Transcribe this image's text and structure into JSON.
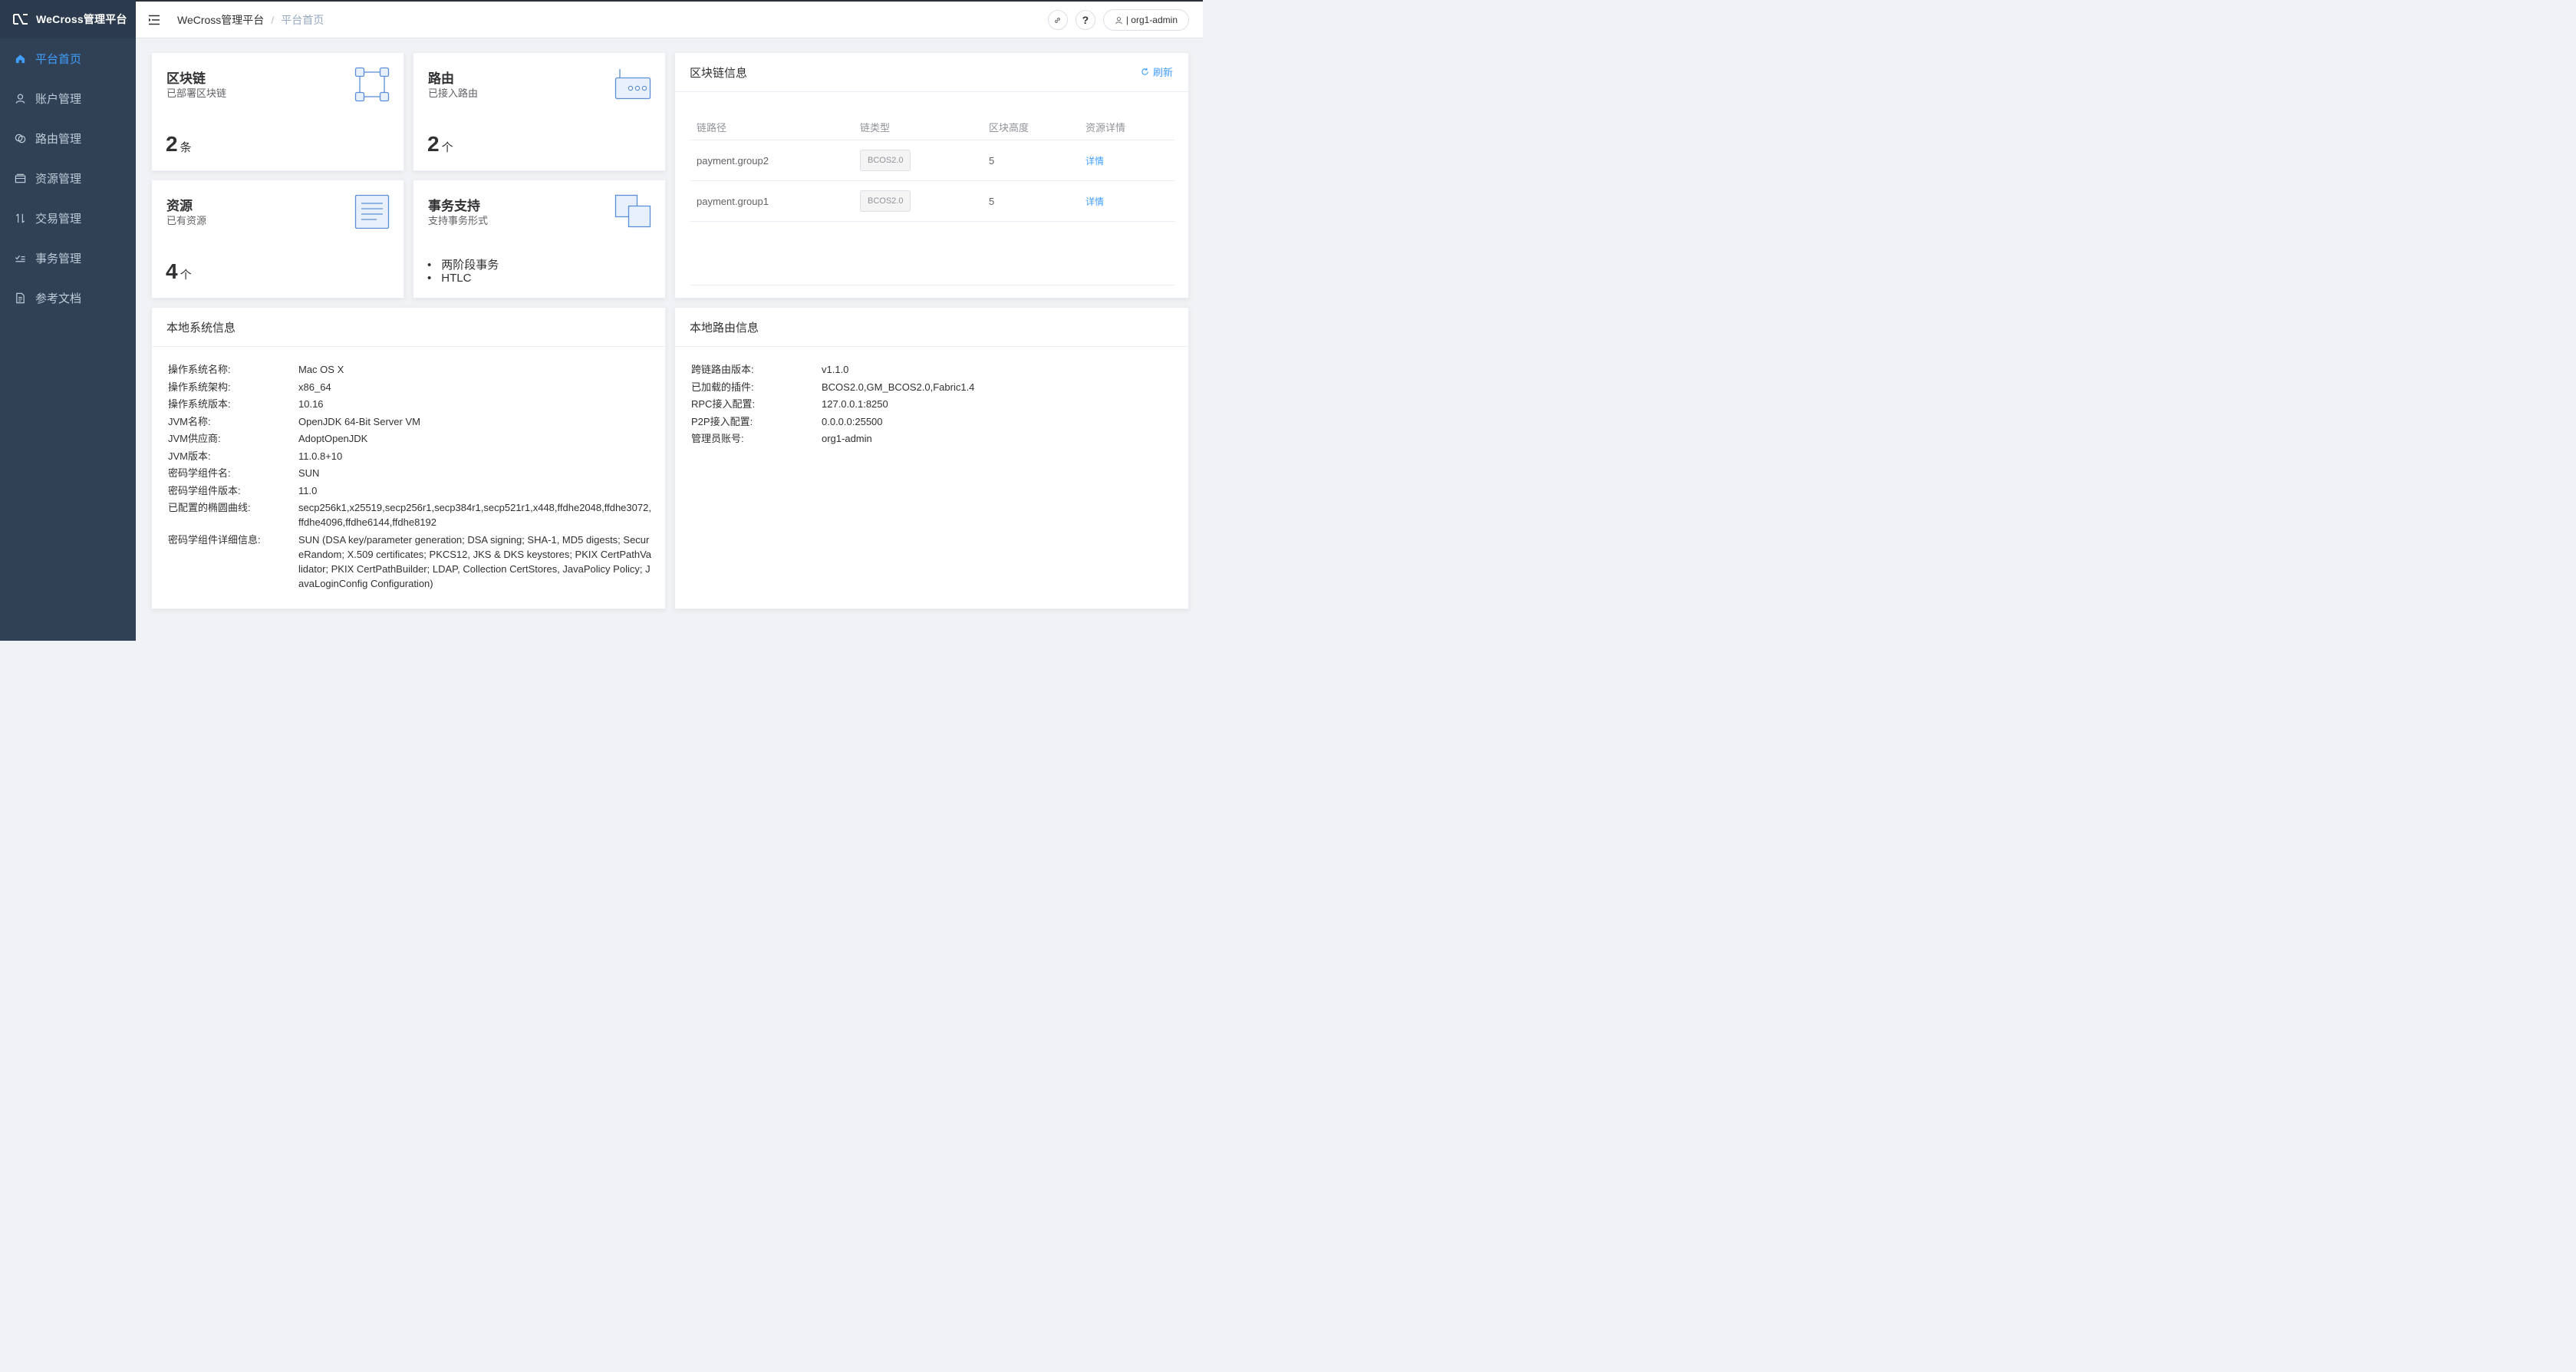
{
  "app": {
    "title": "WeCross管理平台"
  },
  "sidebar": {
    "items": [
      {
        "label": "平台首页",
        "icon": "home-icon",
        "active": true
      },
      {
        "label": "账户管理",
        "icon": "user-icon",
        "active": false
      },
      {
        "label": "路由管理",
        "icon": "router-icon",
        "active": false
      },
      {
        "label": "资源管理",
        "icon": "folder-icon",
        "active": false
      },
      {
        "label": "交易管理",
        "icon": "transaction-icon",
        "active": false
      },
      {
        "label": "事务管理",
        "icon": "check-list-icon",
        "active": false
      },
      {
        "label": "参考文档",
        "icon": "document-icon",
        "active": false
      }
    ]
  },
  "header": {
    "breadcrumb": {
      "home": "WeCross管理平台",
      "sep": "/",
      "current": "平台首页"
    },
    "user": "| org1-admin",
    "help": "?"
  },
  "stats": {
    "chains": {
      "title": "区块链",
      "sub": "已部署区块链",
      "value": "2",
      "unit": "条"
    },
    "routers": {
      "title": "路由",
      "sub": "已接入路由",
      "value": "2",
      "unit": "个"
    },
    "resources": {
      "title": "资源",
      "sub": "已有资源",
      "value": "4",
      "unit": "个"
    },
    "transactions": {
      "title": "事务支持",
      "sub": "支持事务形式",
      "items": [
        "两阶段事务",
        "HTLC"
      ]
    }
  },
  "chain_info": {
    "title": "区块链信息",
    "refresh": "刷新",
    "columns": [
      "链路径",
      "链类型",
      "区块高度",
      "资源详情"
    ],
    "rows": [
      {
        "path": "payment.group2",
        "type": "BCOS2.0",
        "height": "5",
        "detail": "详情"
      },
      {
        "path": "payment.group1",
        "type": "BCOS2.0",
        "height": "5",
        "detail": "详情"
      }
    ]
  },
  "system_info": {
    "title": "本地系统信息",
    "rows": [
      {
        "k": "操作系统名称:",
        "v": "Mac OS X"
      },
      {
        "k": "操作系统架构:",
        "v": "x86_64"
      },
      {
        "k": "操作系统版本:",
        "v": "10.16"
      },
      {
        "k": "JVM名称:",
        "v": "OpenJDK 64-Bit Server VM"
      },
      {
        "k": "JVM供应商:",
        "v": "AdoptOpenJDK"
      },
      {
        "k": "JVM版本:",
        "v": "11.0.8+10"
      },
      {
        "k": "密码学组件名:",
        "v": "SUN"
      },
      {
        "k": "密码学组件版本:",
        "v": "11.0"
      },
      {
        "k": "已配置的椭圆曲线:",
        "v": "secp256k1,x25519,secp256r1,secp384r1,secp521r1,x448,ffdhe2048,ffdhe3072,ffdhe4096,ffdhe6144,ffdhe8192"
      },
      {
        "k": "密码学组件详细信息:",
        "v": "SUN (DSA key/parameter generation; DSA signing; SHA-1, MD5 digests; SecureRandom; X.509 certificates; PKCS12, JKS & DKS keystores; PKIX CertPathValidator; PKIX CertPathBuilder; LDAP, Collection CertStores, JavaPolicy Policy; JavaLoginConfig Configuration)"
      }
    ]
  },
  "router_info": {
    "title": "本地路由信息",
    "rows": [
      {
        "k": "跨链路由版本:",
        "v": "v1.1.0"
      },
      {
        "k": "已加载的插件:",
        "v": "BCOS2.0,GM_BCOS2.0,Fabric1.4"
      },
      {
        "k": "RPC接入配置:",
        "v": "127.0.0.1:8250"
      },
      {
        "k": "P2P接入配置:",
        "v": "0.0.0.0:25500"
      },
      {
        "k": "管理员账号:",
        "v": "org1-admin"
      }
    ]
  },
  "colors": {
    "sidebar": "#304156",
    "accent": "#409eff",
    "icon_blue": "#5a8fd8"
  }
}
